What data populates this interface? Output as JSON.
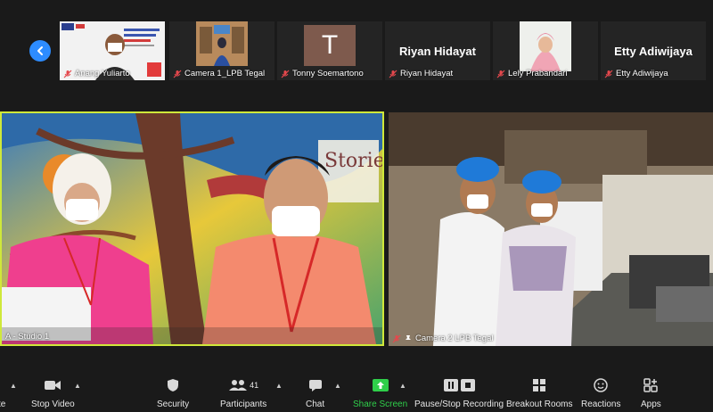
{
  "strip": {
    "participants": [
      {
        "name": "Anang Yuliarto",
        "muted": true,
        "kind": "video"
      },
      {
        "name": "Camera 1_LPB Tegal",
        "muted": true,
        "kind": "video"
      },
      {
        "name": "Tonny Soemartono",
        "muted": true,
        "kind": "avatar",
        "initial": "T"
      },
      {
        "name": "Riyan Hidayat",
        "muted": true,
        "kind": "name",
        "display_name": "Riyan Hidayat"
      },
      {
        "name": "Lely Prabandari",
        "muted": true,
        "kind": "video"
      },
      {
        "name": "Etty Adiwijaya",
        "muted": true,
        "kind": "name",
        "display_name": "Etty Adiwijaya"
      }
    ]
  },
  "main": {
    "speaker_label": "A - Studio 1",
    "second_label": "Camera 2 LPB Tegal"
  },
  "toolbar": {
    "audio_label": "te",
    "stop_video_label": "Stop Video",
    "security_label": "Security",
    "participants_label": "Participants",
    "participants_count": "41",
    "chat_label": "Chat",
    "share_label": "Share Screen",
    "recording_label": "Pause/Stop Recording",
    "breakout_label": "Breakout Rooms",
    "reactions_label": "Reactions",
    "apps_label": "Apps"
  },
  "colors": {
    "active_speaker_border": "#cfe83a",
    "share_green": "#2fcf4a",
    "accent_blue": "#2d8cff",
    "muted_red": "#e5484d"
  }
}
